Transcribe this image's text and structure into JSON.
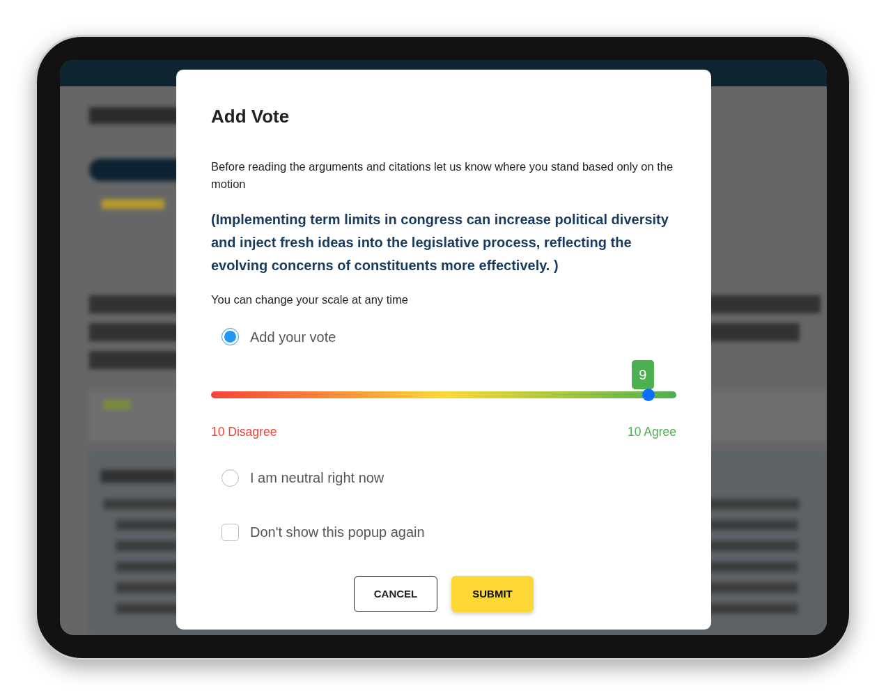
{
  "dialog": {
    "title": "Add Vote",
    "intro": "Before reading the arguments and citations let us know where you stand based only on the motion",
    "motion": "(Implementing term limits in congress can increase political diversity and inject fresh ideas into the legislative process, reflecting the evolving concerns of constituents more effectively. )",
    "hint": "You can change your scale at any time",
    "options": [
      {
        "label": "Add your vote",
        "selected": true
      },
      {
        "label": "I am neutral right now",
        "selected": false
      }
    ],
    "slider": {
      "level": 0.94,
      "value": "9",
      "min_label": "10 Disagree",
      "max_label": "10 Agree"
    },
    "dont_show": {
      "label": "Don't show this popup again",
      "checked": false
    },
    "buttons": [
      {
        "label": "CANCEL",
        "kind": "outline"
      },
      {
        "label": "SUBMIT",
        "kind": "primary"
      }
    ]
  }
}
